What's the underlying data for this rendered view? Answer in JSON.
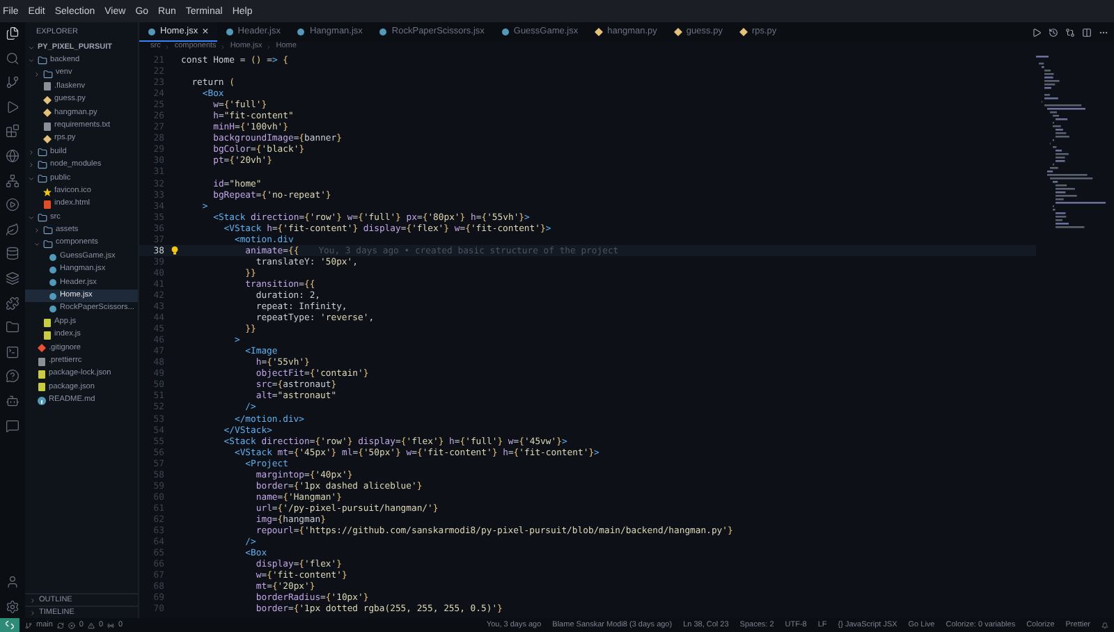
{
  "menu": [
    "File",
    "Edit",
    "Selection",
    "View",
    "Go",
    "Run",
    "Terminal",
    "Help"
  ],
  "explorer": {
    "title": "EXPLORER",
    "root": "PY_PIXEL_PURSUIT",
    "items": [
      {
        "label": "backend",
        "kind": "folder",
        "expanded": true,
        "selected": false,
        "children": [
          {
            "label": "venv",
            "kind": "folder",
            "expanded": false,
            "selected": false
          },
          {
            "label": ".flaskenv",
            "kind": "text",
            "selected": false
          },
          {
            "label": "guess.py",
            "kind": "python",
            "selected": false
          },
          {
            "label": "hangman.py",
            "kind": "python",
            "selected": false
          },
          {
            "label": "requirements.txt",
            "kind": "text",
            "selected": false
          },
          {
            "label": "rps.py",
            "kind": "python",
            "selected": false
          }
        ]
      },
      {
        "label": "build",
        "kind": "folder",
        "expanded": false,
        "selected": false
      },
      {
        "label": "node_modules",
        "kind": "folder",
        "expanded": false,
        "selected": false
      },
      {
        "label": "public",
        "kind": "folder",
        "expanded": true,
        "selected": false,
        "children": [
          {
            "label": "favicon.ico",
            "kind": "star",
            "selected": false
          },
          {
            "label": "index.html",
            "kind": "html",
            "selected": false
          }
        ]
      },
      {
        "label": "src",
        "kind": "folder",
        "expanded": true,
        "selected": false,
        "children": [
          {
            "label": "assets",
            "kind": "folder",
            "expanded": false,
            "selected": false
          },
          {
            "label": "components",
            "kind": "folder",
            "expanded": true,
            "selected": false,
            "children": [
              {
                "label": "GuessGame.jsx",
                "kind": "react",
                "selected": false
              },
              {
                "label": "Hangman.jsx",
                "kind": "react",
                "selected": false
              },
              {
                "label": "Header.jsx",
                "kind": "react",
                "selected": false
              },
              {
                "label": "Home.jsx",
                "kind": "react",
                "selected": true
              },
              {
                "label": "RockPaperScissors...",
                "kind": "react",
                "selected": false
              }
            ]
          },
          {
            "label": "App.js",
            "kind": "js",
            "selected": false
          },
          {
            "label": "index.js",
            "kind": "js",
            "selected": false
          }
        ]
      },
      {
        "label": ".gitignore",
        "kind": "git",
        "selected": false
      },
      {
        "label": ".prettierrc",
        "kind": "text",
        "selected": false
      },
      {
        "label": "package-lock.json",
        "kind": "json",
        "selected": false
      },
      {
        "label": "package.json",
        "kind": "json",
        "selected": false
      },
      {
        "label": "README.md",
        "kind": "info",
        "selected": false
      }
    ],
    "sections": [
      "OUTLINE",
      "TIMELINE"
    ]
  },
  "tabs": [
    {
      "label": "Home.jsx",
      "kind": "react",
      "selected": true
    },
    {
      "label": "Header.jsx",
      "kind": "react",
      "selected": false
    },
    {
      "label": "Hangman.jsx",
      "kind": "react",
      "selected": false
    },
    {
      "label": "RockPaperScissors.jsx",
      "kind": "react",
      "selected": false
    },
    {
      "label": "GuessGame.jsx",
      "kind": "react",
      "selected": false
    },
    {
      "label": "hangman.py",
      "kind": "python",
      "selected": false
    },
    {
      "label": "guess.py",
      "kind": "python",
      "selected": false
    },
    {
      "label": "rps.py",
      "kind": "python",
      "selected": false
    }
  ],
  "tab_close": "×",
  "breadcrumb": [
    "src",
    "components",
    "Home.jsx",
    "Home"
  ],
  "code": [
    {
      "number": "21",
      "text": "const Home = () => {",
      "current": false
    },
    {
      "number": "22",
      "current": false
    },
    {
      "number": "23",
      "text": "  return (",
      "current": false
    },
    {
      "number": "24",
      "text": "    <Box",
      "current": false
    },
    {
      "number": "25",
      "text": "      w={'full'}",
      "current": false
    },
    {
      "number": "26",
      "text": "      h=\"fit-content\"",
      "current": false
    },
    {
      "number": "27",
      "text": "      minH={'100vh'}",
      "current": false
    },
    {
      "number": "28",
      "text": "      backgroundImage={banner}",
      "current": false
    },
    {
      "number": "29",
      "text": "      bgColor={'black'}",
      "current": false
    },
    {
      "number": "30",
      "text": "      pt={'20vh'}",
      "current": false
    },
    {
      "number": "31",
      "current": false
    },
    {
      "number": "32",
      "text": "      id=\"home\"",
      "current": false
    },
    {
      "number": "33",
      "text": "      bgRepeat={'no-repeat'}",
      "current": false
    },
    {
      "number": "34",
      "text": "    >",
      "current": false
    },
    {
      "number": "35",
      "text": "      <Stack direction={'row'} w={'full'} px={'80px'} h={'55vh'}>",
      "current": false
    },
    {
      "number": "36",
      "text": "        <VStack h={'fit-content'} display={'flex'} w={'fit-content'}>",
      "current": false
    },
    {
      "number": "37",
      "text": "          <motion.div",
      "current": false
    },
    {
      "number": "38",
      "text": "            animate={{",
      "current": true,
      "blame": "You, 3 days ago • created basic structure of the project"
    },
    {
      "number": "39",
      "text": "              translateY: '50px',",
      "current": false
    },
    {
      "number": "40",
      "text": "            }}",
      "current": false
    },
    {
      "number": "41",
      "text": "            transition={{",
      "current": false
    },
    {
      "number": "42",
      "text": "              duration: 2,",
      "current": false
    },
    {
      "number": "43",
      "text": "              repeat: Infinity,",
      "current": false
    },
    {
      "number": "44",
      "text": "              repeatType: 'reverse',",
      "current": false
    },
    {
      "number": "45",
      "text": "            }}",
      "current": false
    },
    {
      "number": "46",
      "text": "          >",
      "current": false
    },
    {
      "number": "47",
      "text": "            <Image",
      "current": false
    },
    {
      "number": "48",
      "text": "              h={'55vh'}",
      "current": false
    },
    {
      "number": "49",
      "text": "              objectFit={'contain'}",
      "current": false
    },
    {
      "number": "50",
      "text": "              src={astronaut}",
      "current": false
    },
    {
      "number": "51",
      "text": "              alt=\"astronaut\"",
      "current": false
    },
    {
      "number": "52",
      "text": "            />",
      "current": false
    },
    {
      "number": "53",
      "text": "          </motion.div>",
      "current": false
    },
    {
      "number": "54",
      "text": "        </VStack>",
      "current": false
    },
    {
      "number": "55",
      "text": "        <Stack direction={'row'} display={'flex'} h={'full'} w={'45vw'}>",
      "current": false
    },
    {
      "number": "56",
      "text": "          <VStack mt={'45px'} ml={'50px'} w={'fit-content'} h={'fit-content'}>",
      "current": false
    },
    {
      "number": "57",
      "text": "            <Project",
      "current": false
    },
    {
      "number": "58",
      "text": "              margintop={'40px'}",
      "current": false
    },
    {
      "number": "59",
      "text": "              border={'1px dashed aliceblue'}",
      "current": false
    },
    {
      "number": "60",
      "text": "              name={'Hangman'}",
      "current": false
    },
    {
      "number": "61",
      "text": "              url={'/py-pixel-pursuit/hangman/'}",
      "current": false
    },
    {
      "number": "62",
      "text": "              img={hangman}",
      "current": false
    },
    {
      "number": "63",
      "text": "              repourl={'https://github.com/sanskarmodi8/py-pixel-pursuit/blob/main/backend/hangman.py'}",
      "current": false
    },
    {
      "number": "64",
      "text": "            />",
      "current": false
    },
    {
      "number": "65",
      "text": "            <Box",
      "current": false
    },
    {
      "number": "66",
      "text": "              display={'flex'}",
      "current": false
    },
    {
      "number": "67",
      "text": "              w={'fit-content'}",
      "current": false
    },
    {
      "number": "68",
      "text": "              mt={'20px'}",
      "current": false
    },
    {
      "number": "69",
      "text": "              borderRadius={'10px'}",
      "current": false
    },
    {
      "number": "70",
      "text": "              border={'1px dotted rgba(255, 255, 255, 0.5)'}",
      "current": false
    }
  ],
  "status_bar": {
    "branch": "main",
    "errors": "0",
    "warnings": "0",
    "ports": "0",
    "right": [
      "You, 3 days ago",
      "Blame Sanskar Modi8 (3 days ago)",
      "Ln 38, Col 23",
      "Spaces: 2",
      "UTF-8",
      "LF",
      "{} JavaScript JSX",
      "Go Live",
      "Colorize: 0 variables",
      "Colorize",
      "Prettier"
    ]
  }
}
